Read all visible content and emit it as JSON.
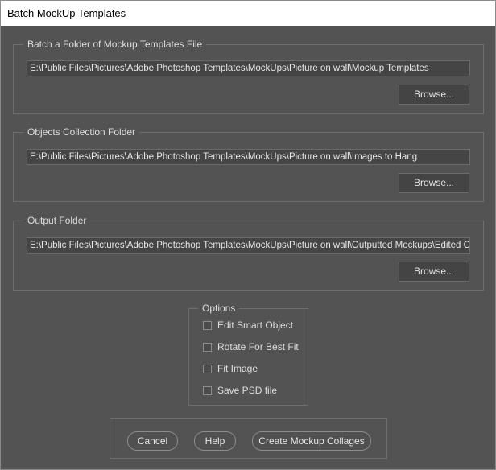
{
  "window": {
    "title": "Batch MockUp Templates"
  },
  "sections": [
    {
      "label": "Batch a Folder of Mockup Templates File",
      "path": "E:\\Public Files\\Pictures\\Adobe Photoshop Templates\\MockUps\\Picture on wall\\Mockup Templates",
      "browse_label": "Browse..."
    },
    {
      "label": "Objects Collection Folder",
      "path": "E:\\Public Files\\Pictures\\Adobe Photoshop Templates\\MockUps\\Picture on wall\\Images to Hang",
      "browse_label": "Browse..."
    },
    {
      "label": "Output Folder",
      "path": "E:\\Public Files\\Pictures\\Adobe Photoshop Templates\\MockUps\\Picture on wall\\Outputted Mockups\\Edited Objects",
      "browse_label": "Browse..."
    }
  ],
  "options": {
    "label": "Options",
    "items": [
      {
        "label": "Edit Smart Object",
        "checked": false
      },
      {
        "label": "Rotate For Best Fit",
        "checked": false
      },
      {
        "label": "Fit Image",
        "checked": false
      },
      {
        "label": "Save PSD file",
        "checked": false
      }
    ]
  },
  "actions": {
    "cancel": "Cancel",
    "help": "Help",
    "create": "Create Mockup Collages"
  }
}
